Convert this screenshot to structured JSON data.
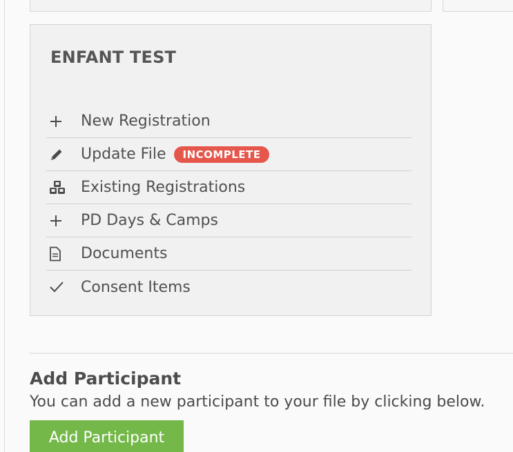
{
  "participant_card": {
    "title": "ENFANT TEST",
    "menu": [
      {
        "label": "New Registration",
        "icon": "plus-icon"
      },
      {
        "label": "Update File",
        "icon": "pencil-icon",
        "badge": "INCOMPLETE"
      },
      {
        "label": "Existing Registrations",
        "icon": "cubes-icon"
      },
      {
        "label": "PD Days & Camps",
        "icon": "plus-icon"
      },
      {
        "label": "Documents",
        "icon": "document-icon"
      },
      {
        "label": "Consent Items",
        "icon": "checkmark-icon"
      }
    ]
  },
  "add_participant": {
    "title": "Add Participant",
    "description": "You can add a new participant to your file by clicking below.",
    "button_label": "Add Participant"
  },
  "colors": {
    "badge_red": "#e5564b",
    "button_green": "#74b84a",
    "card_bg": "#f1f1f1"
  }
}
